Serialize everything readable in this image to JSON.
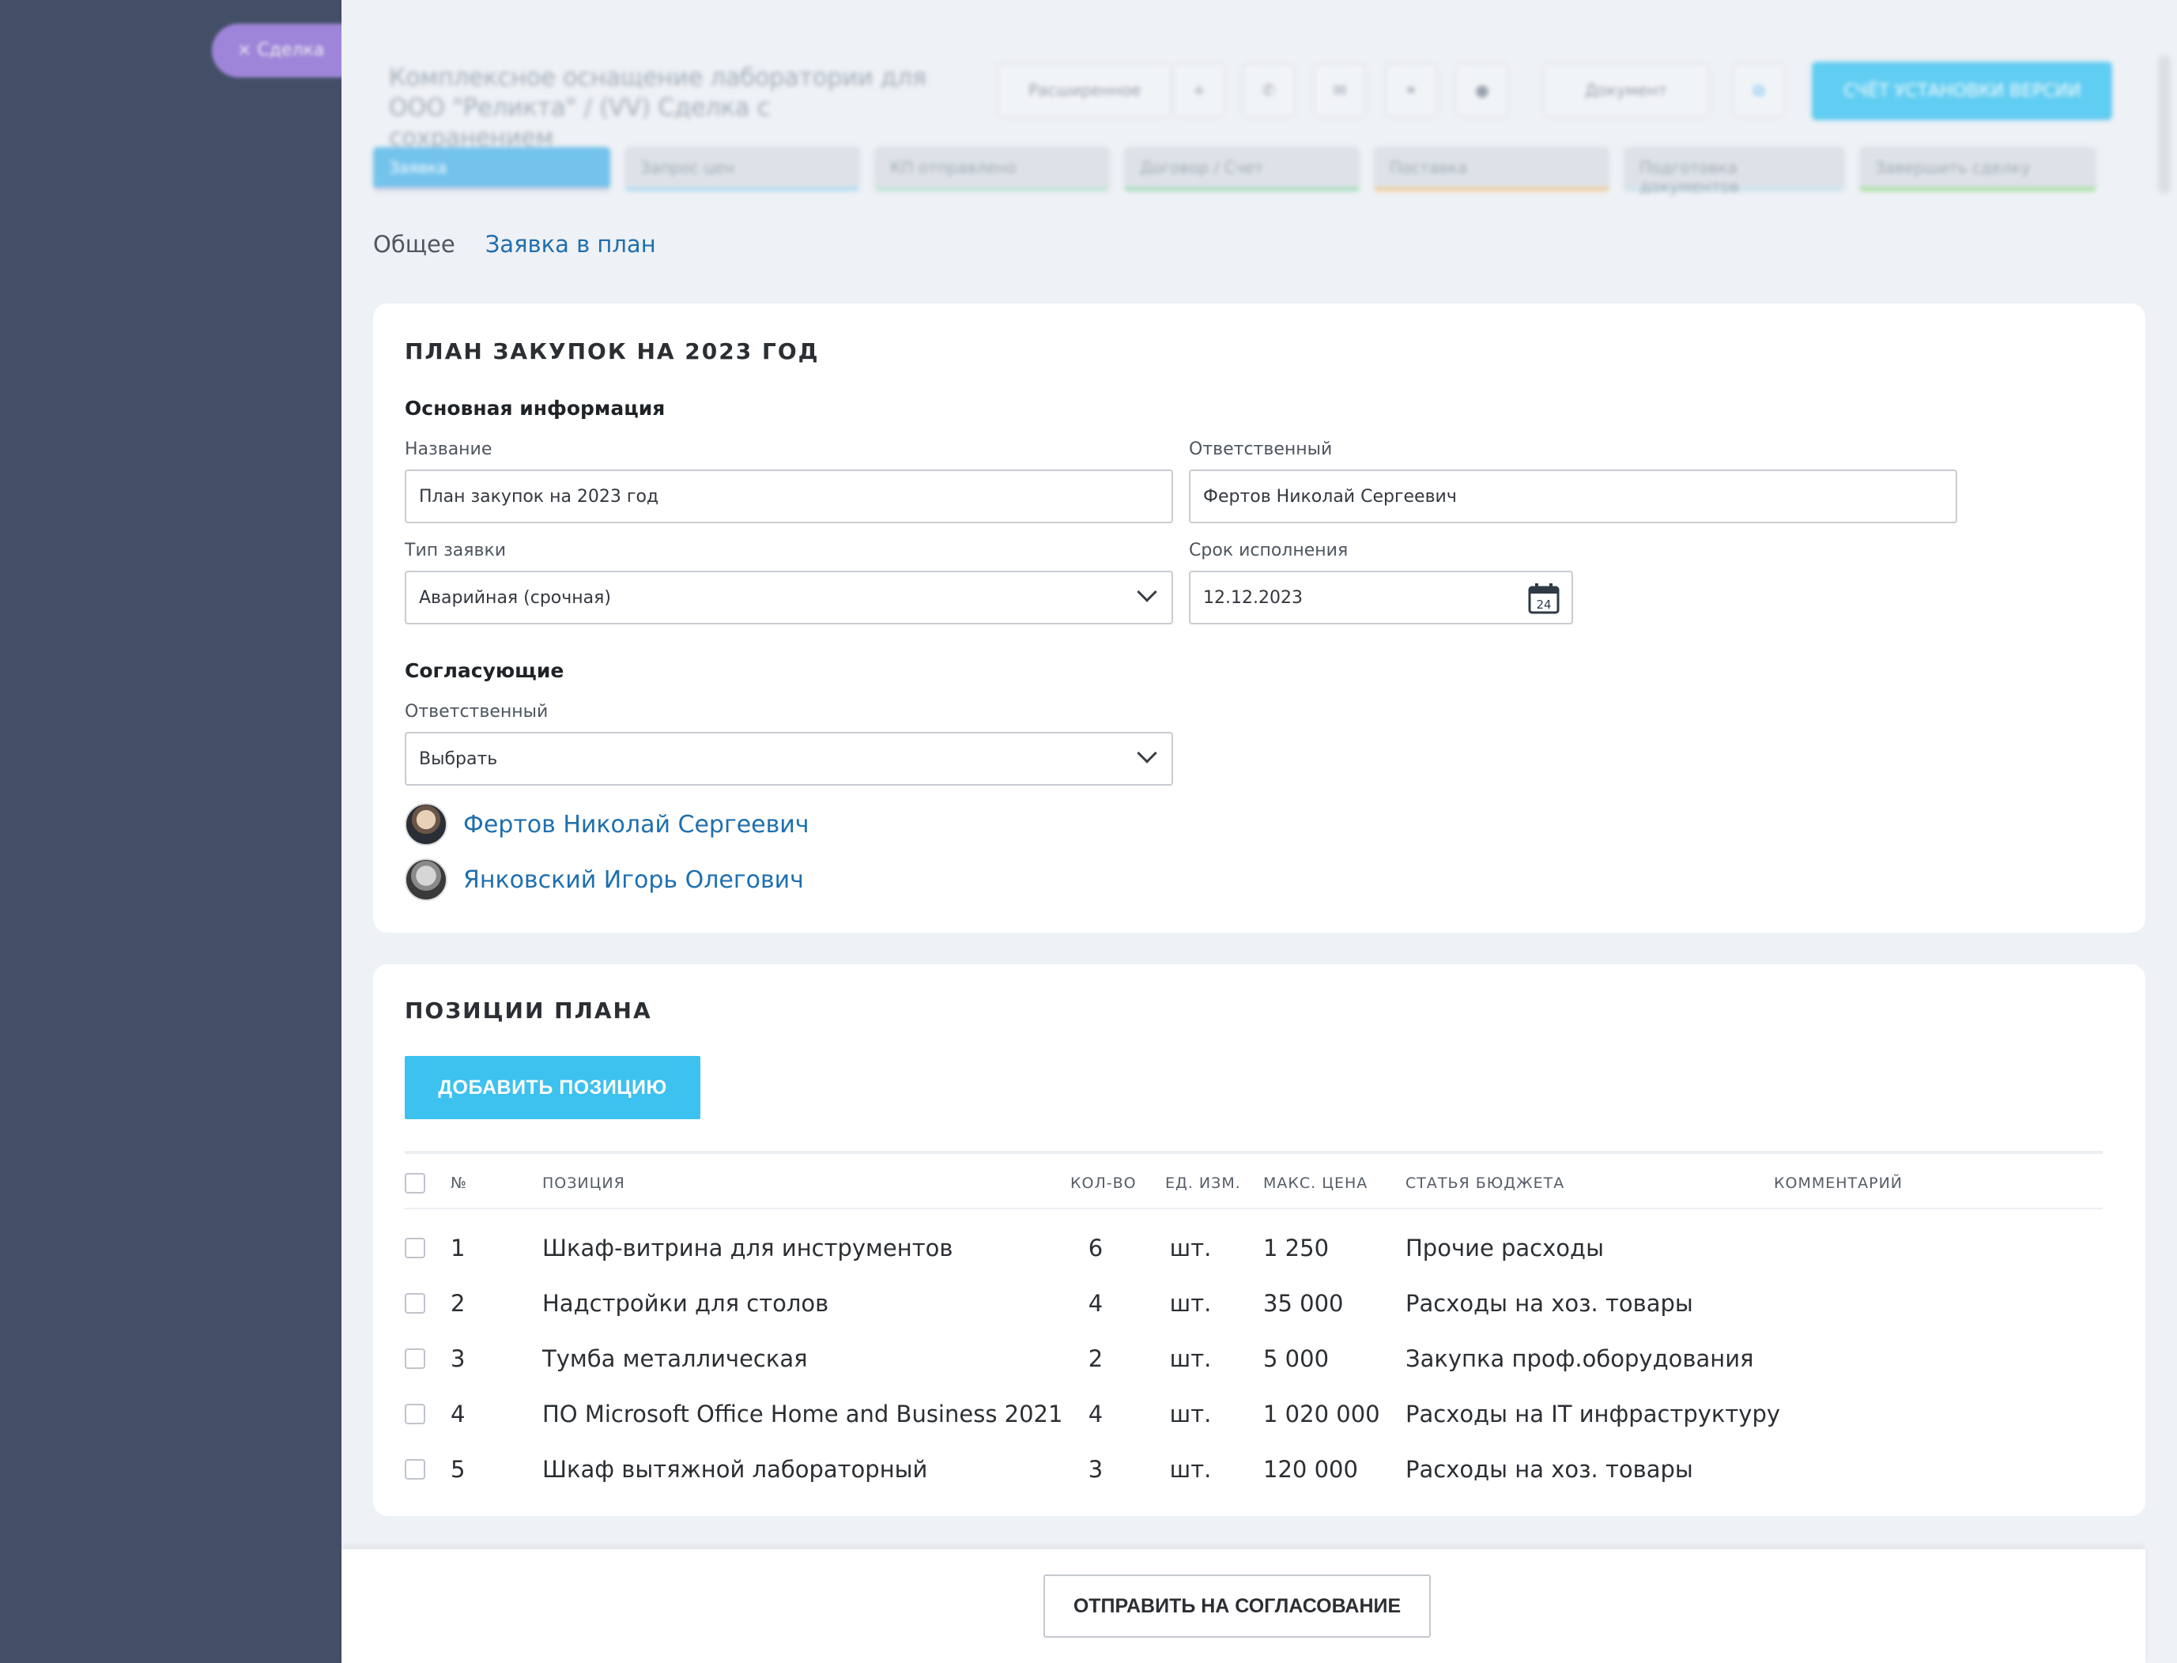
{
  "sidebar": {
    "pill_label": "× Сделка"
  },
  "header": {
    "deal_title": "Комплексное оснащение лаборатории для ООО \"Реликта\" / (VV) Сделка с сохранением",
    "buttons": [
      "Расширенное",
      "+",
      "Документ",
      "Счёт установки"
    ],
    "primary_button": "СЧЁТ УСТАНОВКИ ВЕРСИИ",
    "stages": [
      "Заявка",
      "Запрос цен",
      "КП отправлено",
      "Договор / Счет",
      "Поставка",
      "Подготовка документов",
      "Завершить сделку"
    ]
  },
  "tabs": {
    "general": "Общее",
    "plan": "Заявка в план"
  },
  "plan_card": {
    "title": "ПЛАН ЗАКУПОК НА 2023 ГОД",
    "basic_section": "Основная информация",
    "name_label": "Название",
    "name_value": "План закупок на 2023 год",
    "responsible_label": "Ответственный",
    "responsible_value": "Фертов Николай Сергеевич",
    "type_label": "Тип заявки",
    "type_value": "Аварийная (срочная)",
    "deadline_label": "Срок исполнения",
    "deadline_value": "12.12.2023",
    "calendar_day": "24",
    "approvers_section": "Согласующие",
    "approver_label": "Ответственный",
    "approver_select": "Выбрать",
    "approvers": [
      "Фертов Николай Сергеевич",
      "Янковский Игорь Олегович"
    ]
  },
  "positions_card": {
    "title": "ПОЗИЦИИ ПЛАНА",
    "add_button": "ДОБАВИТЬ ПОЗИЦИЮ",
    "columns": [
      "№",
      "ПОЗИЦИЯ",
      "КОЛ-ВО",
      "ЕД. ИЗМ.",
      "МАКС. ЦЕНА",
      "СТАТЬЯ БЮДЖЕТА",
      "КОММЕНТАРИЙ"
    ],
    "rows": [
      {
        "num": "1",
        "name": "Шкаф-витрина для инструментов",
        "qty": "6",
        "unit": "шт.",
        "price": "1 250",
        "budget": "Прочие расходы",
        "comment": ""
      },
      {
        "num": "2",
        "name": "Надстройки для столов",
        "qty": "4",
        "unit": "шт.",
        "price": "35 000",
        "budget": "Расходы на хоз. товары",
        "comment": ""
      },
      {
        "num": "3",
        "name": "Тумба металлическая",
        "qty": "2",
        "unit": "шт.",
        "price": "5 000",
        "budget": "Закупка проф.оборудования",
        "comment": ""
      },
      {
        "num": "4",
        "name": "ПО Microsoft Office Home and Business 2021",
        "qty": "4",
        "unit": "шт.",
        "price": "1 020 000",
        "budget": "Расходы на IT инфраструктуру",
        "comment": ""
      },
      {
        "num": "5",
        "name": "Шкаф вытяжной лабораторный",
        "qty": "3",
        "unit": "шт.",
        "price": "120 000",
        "budget": "Расходы на хоз. товары",
        "comment": ""
      }
    ]
  },
  "footer": {
    "send_button": "ОТПРАВИТЬ НА СОГЛАСОВАНИЕ"
  }
}
